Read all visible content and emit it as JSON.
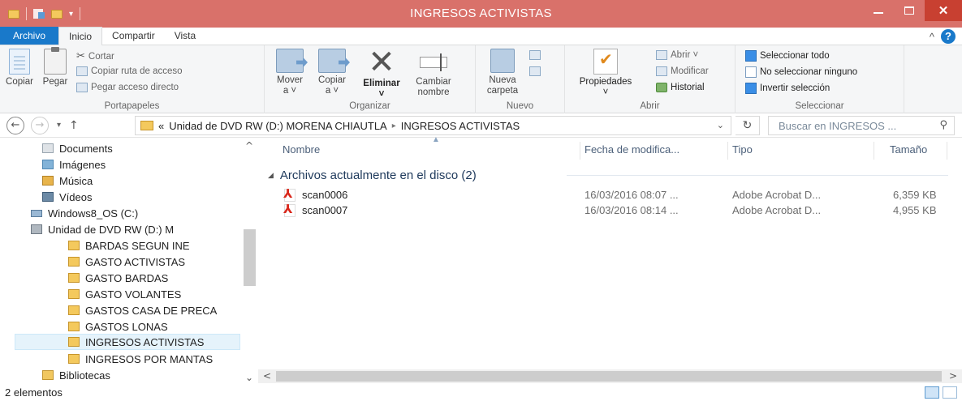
{
  "window": {
    "title": "INGRESOS ACTIVISTAS"
  },
  "tabs": [
    {
      "label": "Archivo"
    },
    {
      "label": "Inicio"
    },
    {
      "label": "Compartir"
    },
    {
      "label": "Vista"
    }
  ],
  "ribbon": {
    "portapapeles": {
      "label": "Portapapeles",
      "copiar": "Copiar",
      "pegar": "Pegar",
      "cortar": "Cortar",
      "copiar_ruta": "Copiar ruta de acceso",
      "pegar_acceso": "Pegar acceso directo"
    },
    "organizar": {
      "label": "Organizar",
      "mover_1": "Mover",
      "mover_2": "a ˅",
      "copiar_1": "Copiar",
      "copiar_2": "a ˅",
      "eliminar": "Eliminar",
      "eliminar_2": "˅",
      "cambiar_1": "Cambiar",
      "cambiar_2": "nombre"
    },
    "nuevo": {
      "label": "Nuevo",
      "nueva_1": "Nueva",
      "nueva_2": "carpeta"
    },
    "abrir": {
      "label": "Abrir",
      "propiedades": "Propiedades",
      "propiedades_2": "˅",
      "abrir": "Abrir ˅",
      "modificar": "Modificar",
      "historial": "Historial"
    },
    "seleccionar": {
      "label": "Seleccionar",
      "todo": "Seleccionar todo",
      "ninguno": "No seleccionar ninguno",
      "invertir": "Invertir selección"
    }
  },
  "address": {
    "prefix": "«",
    "segment1": "Unidad de DVD RW (D:) MORENA CHIAUTLA",
    "separator": "▸",
    "segment2": "INGRESOS ACTIVISTAS"
  },
  "search": {
    "placeholder": "Buscar en INGRESOS ..."
  },
  "nav_items": [
    {
      "label": "Documents",
      "icon": "documents-icon"
    },
    {
      "label": "Imágenes",
      "icon": "pictures-icon"
    },
    {
      "label": "Música",
      "icon": "music-icon"
    },
    {
      "label": "Vídeos",
      "icon": "videos-icon"
    },
    {
      "label": "Windows8_OS (C:)",
      "icon": "drive-icon"
    },
    {
      "label": "Unidad de DVD RW (D:) M",
      "icon": "dvd-drive-icon"
    },
    {
      "label": "BARDAS SEGUN INE",
      "icon": "folder-icon"
    },
    {
      "label": "GASTO ACTIVISTAS",
      "icon": "folder-icon"
    },
    {
      "label": "GASTO BARDAS",
      "icon": "folder-icon"
    },
    {
      "label": "GASTO VOLANTES",
      "icon": "folder-icon"
    },
    {
      "label": "GASTOS CASA DE PRECA",
      "icon": "folder-icon"
    },
    {
      "label": "GASTOS LONAS",
      "icon": "folder-icon"
    },
    {
      "label": "INGRESOS ACTIVISTAS",
      "icon": "folder-icon",
      "selected": true
    },
    {
      "label": "INGRESOS POR MANTAS",
      "icon": "folder-icon"
    },
    {
      "label": "Bibliotecas",
      "icon": "libraries-icon"
    }
  ],
  "columns": {
    "nombre": "Nombre",
    "fecha": "Fecha de modifica...",
    "tipo": "Tipo",
    "tamano": "Tamaño"
  },
  "group": {
    "label": "Archivos actualmente en el disco (2)"
  },
  "files": [
    {
      "name": "scan0006",
      "date": "16/03/2016 08:07 ...",
      "type": "Adobe Acrobat D...",
      "size": "6,359 KB"
    },
    {
      "name": "scan0007",
      "date": "16/03/2016 08:14 ...",
      "type": "Adobe Acrobat D...",
      "size": "4,955 KB"
    }
  ],
  "status": {
    "count": "2 elementos"
  },
  "colors": {
    "titlebar": "#d9716a",
    "file_tab": "#1979ca",
    "close": "#c84031"
  }
}
